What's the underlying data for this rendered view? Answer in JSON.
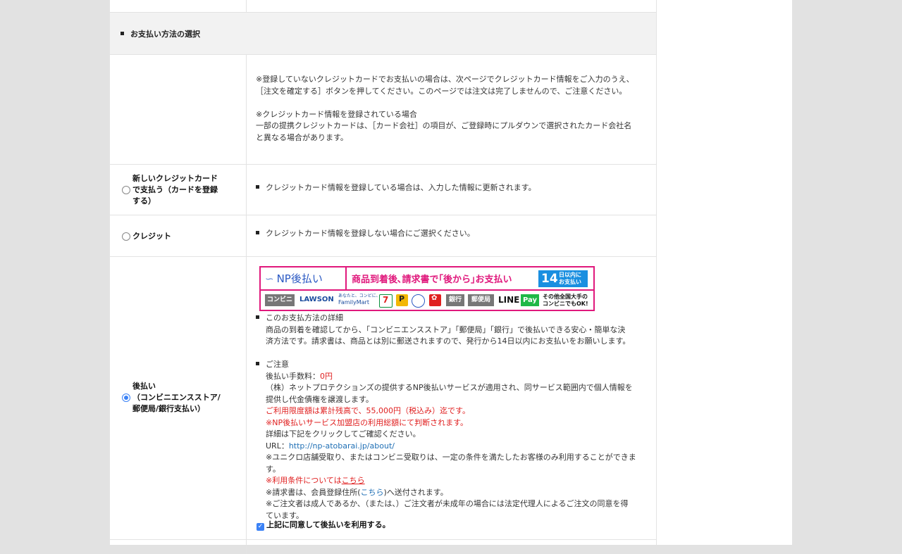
{
  "section": {
    "title": "お支払い方法の選択"
  },
  "intro_note": {
    "lines": [
      "※登録していないクレジットカードでお支払いの場合は、次ページでクレジットカード情報をご入力のうえ、",
      "［注文を確定する］ボタンを押してください。このページでは注文は完了しませんので、ご注意ください。",
      "",
      "※クレジットカード情報を登録されている場合",
      "一部の提携クレジットカードは、［カード会社］の項目が、ご登録時にプルダウンで選択されたカード会社名",
      "と異なる場合があります。"
    ]
  },
  "options": [
    {
      "label_lines": [
        "新しいクレジットカード",
        "で支払う（カードを登録",
        "する）"
      ],
      "selected": false,
      "description": "クレジットカード情報を登録している場合は、入力した情報に更新されます。"
    },
    {
      "label_lines": [
        "クレジット"
      ],
      "selected": false,
      "description": "クレジットカード情報を登録しない場合にご選択ください。"
    },
    {
      "label_lines": [
        "後払い",
        "（コンビニエンスストア/",
        "郵便局/銀行支払い）"
      ],
      "selected": true
    }
  ],
  "np_banner": {
    "logo": "NP後払い",
    "slogan": "商品到着後､請求書で｢後から｣お支払い",
    "badge_big": "14",
    "badge_small": "日以内に お支払い",
    "conv": "コンビニ",
    "lawson": "LAWSON",
    "familymart_top": "あなたと、コンビに、",
    "familymart": "FamilyMart",
    "bank": "銀行",
    "post": "郵便局",
    "line": "LINE",
    "pay": "Pay",
    "other_line1": "その他全国大手の",
    "other_line2": "コンビニでもOK!"
  },
  "np_details": {
    "heading": "このお支払方法の詳細",
    "desc_line1": "商品の到着を確認してから、「コンビニエンスストア」「郵便局」「銀行」で後払いできる安心・簡単な決",
    "desc_line2": "済方法です。請求書は、商品とは別に郵送されますので、発行から14日以内にお支払いをお願いします。",
    "caution_heading": "ご注意",
    "fee_label": "後払い手数料：",
    "fee_value": "0円",
    "service_line1": "（株）ネットプロテクションズの提供するNP後払いサービスが適用され、同サービス範囲内で個人情報を",
    "service_line2": "提供し代金債権を譲渡します。",
    "limit": "ご利用限度額は累計残高で、55,000円（税込み）迄です。",
    "judge": "※NP後払いサービス加盟店の利用総額にて判断されます。",
    "detail_click": "詳細は下記をクリックしてご確認ください。",
    "url_label": "URL：",
    "url": "http://np-atobarai.jp/about/",
    "uniqlo_line1": "※ユニクロ店舗受取り、またはコンビニ受取りは、一定の条件を満たしたお客様のみ利用することができま",
    "uniqlo_line2": "す。",
    "terms_prefix": "※利用条件については",
    "terms_link": "こちら",
    "invoice_prefix": "※請求書は、会員登録住所(",
    "invoice_link": "こちら",
    "invoice_suffix": ")へ送付されます。",
    "minor_line1": "※ご注文者は成人であるか、（または、）ご注文者が未成年の場合には法定代理人によるご注文の同意を得",
    "minor_line2": "ています。",
    "agree_label": "上記に同意して後払いを利用する。",
    "agree_checked": true
  },
  "colors": {
    "accent_blue": "#3b82f6",
    "np_pink": "#e0187c",
    "alert_red": "#e02020",
    "link_blue": "#1f6fb5"
  }
}
